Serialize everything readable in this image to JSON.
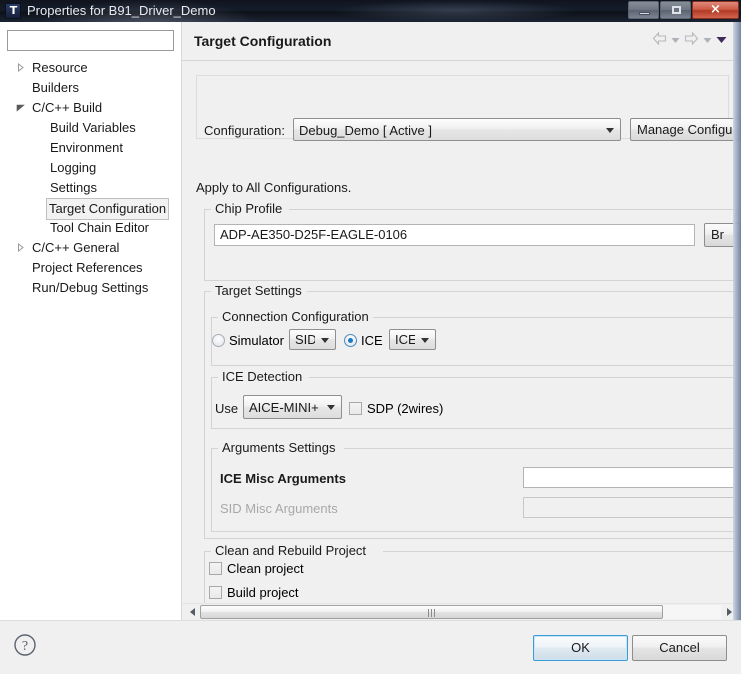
{
  "window": {
    "title": "Properties for B91_Driver_Demo",
    "icon": "app-logo-icon",
    "controls": {
      "minimize": "minimize-icon",
      "maximize": "maximize-icon",
      "close": "×"
    }
  },
  "sidebar": {
    "filter_placeholder": "",
    "filter_value": "",
    "items": [
      {
        "label": "Resource",
        "level": 0,
        "expander": "collapsed",
        "selected": false
      },
      {
        "label": "Builders",
        "level": 0,
        "expander": "none",
        "selected": false
      },
      {
        "label": "C/C++ Build",
        "level": 0,
        "expander": "expanded",
        "selected": false
      },
      {
        "label": "Build Variables",
        "level": 1,
        "expander": "none",
        "selected": false
      },
      {
        "label": "Environment",
        "level": 1,
        "expander": "none",
        "selected": false
      },
      {
        "label": "Logging",
        "level": 1,
        "expander": "none",
        "selected": false
      },
      {
        "label": "Settings",
        "level": 1,
        "expander": "none",
        "selected": false
      },
      {
        "label": "Target Configuration",
        "level": 1,
        "expander": "none",
        "selected": true
      },
      {
        "label": "Tool Chain Editor",
        "level": 1,
        "expander": "none",
        "selected": false
      },
      {
        "label": "C/C++ General",
        "level": 0,
        "expander": "collapsed",
        "selected": false
      },
      {
        "label": "Project References",
        "level": 0,
        "expander": "none",
        "selected": false
      },
      {
        "label": "Run/Debug Settings",
        "level": 0,
        "expander": "none",
        "selected": false
      }
    ]
  },
  "pane": {
    "title": "Target Configuration",
    "nav": {
      "back": "arrow-left-icon",
      "back_menu": "chevron-down-icon",
      "forward": "arrow-right-icon",
      "forward_menu": "chevron-down-icon",
      "view_menu": "chevron-down-filled-icon"
    }
  },
  "configuration": {
    "label": "Configuration:",
    "selected": "Debug_Demo  [ Active ]",
    "manage_button": "Manage Configu"
  },
  "apply_note": "Apply to All Configurations.",
  "chip_profile": {
    "legend": "Chip Profile",
    "value": "ADP-AE350-D25F-EAGLE-0106",
    "browse_button": "Br"
  },
  "target_settings": {
    "legend": "Target Settings",
    "connection": {
      "legend": "Connection Configuration",
      "simulator": {
        "label": "Simulator",
        "checked": false,
        "combo": "SID"
      },
      "ice": {
        "label": "ICE",
        "checked": true,
        "combo": "ICE"
      }
    },
    "ice_detection": {
      "legend": "ICE Detection",
      "use_label": "Use",
      "use_combo": "AICE-MINI+",
      "sdp_checkbox": {
        "label": "SDP (2wires)",
        "checked": false
      }
    },
    "arguments": {
      "legend": "Arguments Settings",
      "ice_misc": {
        "label": "ICE Misc Arguments",
        "value": "",
        "enabled": true
      },
      "sid_misc": {
        "label": "SID Misc Arguments",
        "value": "",
        "enabled": false
      }
    }
  },
  "clean_rebuild": {
    "legend": "Clean and Rebuild Project",
    "clean": {
      "label": "Clean project",
      "checked": false
    },
    "build": {
      "label": "Build project",
      "checked": false
    }
  },
  "footer": {
    "help": "question-mark-icon",
    "ok": "OK",
    "cancel": "Cancel"
  },
  "colors": {
    "accent": "#1e7ac0",
    "dialog_bg": "#f0f0f0",
    "titlebar": "#141c2a",
    "close_button": "#b03a26"
  }
}
